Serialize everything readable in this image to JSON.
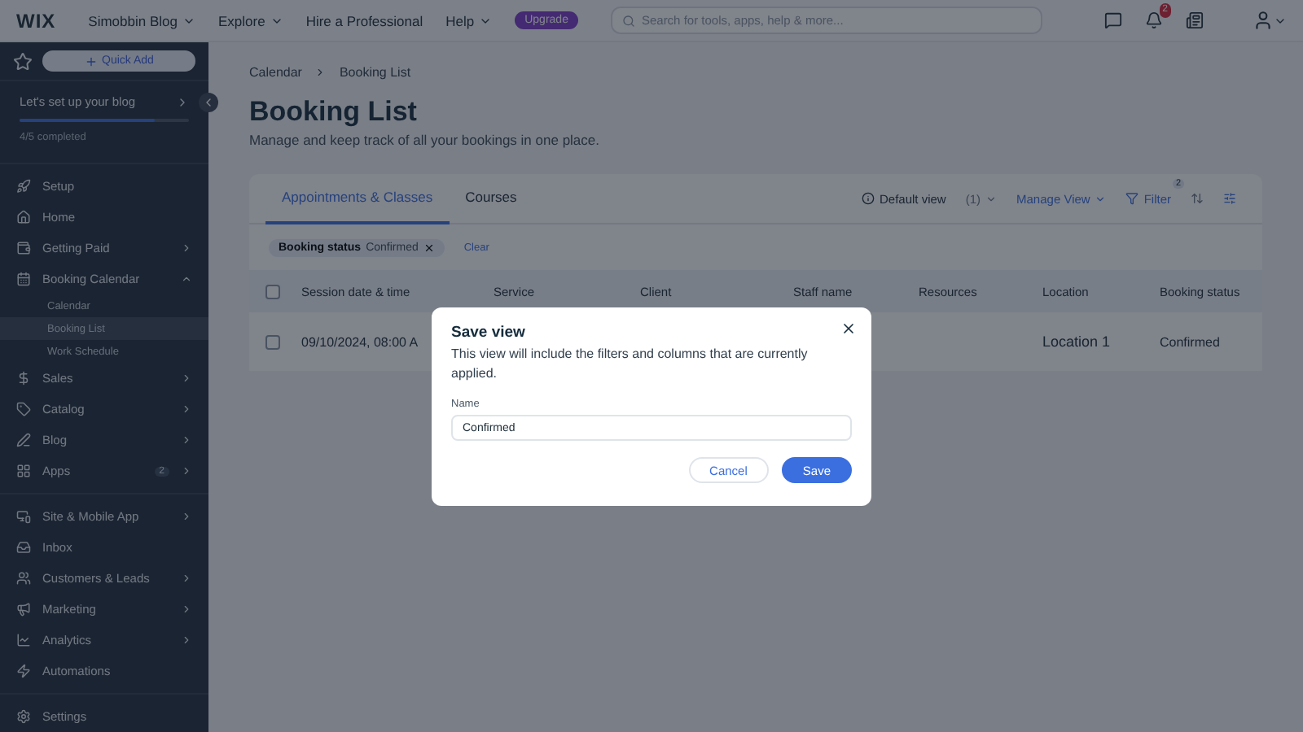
{
  "topbar": {
    "logo": "WIX",
    "site": "Simobbin Blog",
    "nav": [
      {
        "label": "Explore",
        "caret": true
      },
      {
        "label": "Hire a Professional",
        "caret": false
      },
      {
        "label": "Help",
        "caret": true
      }
    ],
    "upgrade": "Upgrade",
    "search": {
      "placeholder": "Search for tools, apps, help & more..."
    },
    "notifications": "2"
  },
  "sidebar": {
    "quick_add": "Quick Add",
    "setup": {
      "title": "Let's set up your blog",
      "level": 0.8,
      "progress": "4/5 completed"
    },
    "groups": [
      [
        {
          "label": "Setup",
          "chevron": false
        },
        {
          "label": "Home",
          "chevron": false
        },
        {
          "label": "Getting Paid",
          "chevron": true
        },
        {
          "label": "Booking Calendar",
          "chevron": true,
          "expanded": true,
          "children": [
            {
              "label": "Calendar",
              "selected": false
            },
            {
              "label": "Booking List",
              "selected": true
            },
            {
              "label": "Work Schedule",
              "selected": false
            }
          ]
        },
        {
          "label": "Sales",
          "chevron": true
        },
        {
          "label": "Catalog",
          "chevron": true
        },
        {
          "label": "Blog",
          "chevron": true
        },
        {
          "label": "Apps",
          "chevron": true,
          "badge": "2"
        }
      ],
      [
        {
          "label": "Site & Mobile App",
          "chevron": true
        },
        {
          "label": "Inbox",
          "chevron": false
        },
        {
          "label": "Customers & Leads",
          "chevron": true
        },
        {
          "label": "Marketing",
          "chevron": true
        },
        {
          "label": "Analytics",
          "chevron": true
        },
        {
          "label": "Automations",
          "chevron": false
        }
      ],
      [
        {
          "label": "Settings",
          "chevron": false
        }
      ]
    ]
  },
  "breadcrumb": [
    "Calendar",
    "Booking List"
  ],
  "page": {
    "title": "Booking List",
    "subtitle": "Manage and keep track of all your bookings in one place."
  },
  "tabs": [
    {
      "label": "Appointments & Classes",
      "selected": true
    },
    {
      "label": "Courses",
      "selected": false
    }
  ],
  "toolbar": {
    "view": "Default view",
    "count": "(1)",
    "manage": "Manage View",
    "filter": "Filter",
    "filter_badge": "2"
  },
  "filter_chip": {
    "label": "Booking status",
    "value": "Confirmed",
    "clear": "Clear"
  },
  "table": {
    "select_all": false,
    "columns": [
      "Session date & time",
      "Service",
      "Client",
      "Staff name",
      "Resources",
      "Location",
      "Booking status"
    ],
    "rows": [
      {
        "checked": false,
        "session": "09/10/2024, 08:00 A",
        "location": "Location 1",
        "status": "Confirmed"
      }
    ]
  },
  "dialog": {
    "title": "Save view",
    "description": "This view will include the filters and columns that are currently applied.",
    "field_label": "Name",
    "value": "Confirmed",
    "buttons": [
      "Cancel",
      "Save"
    ]
  }
}
